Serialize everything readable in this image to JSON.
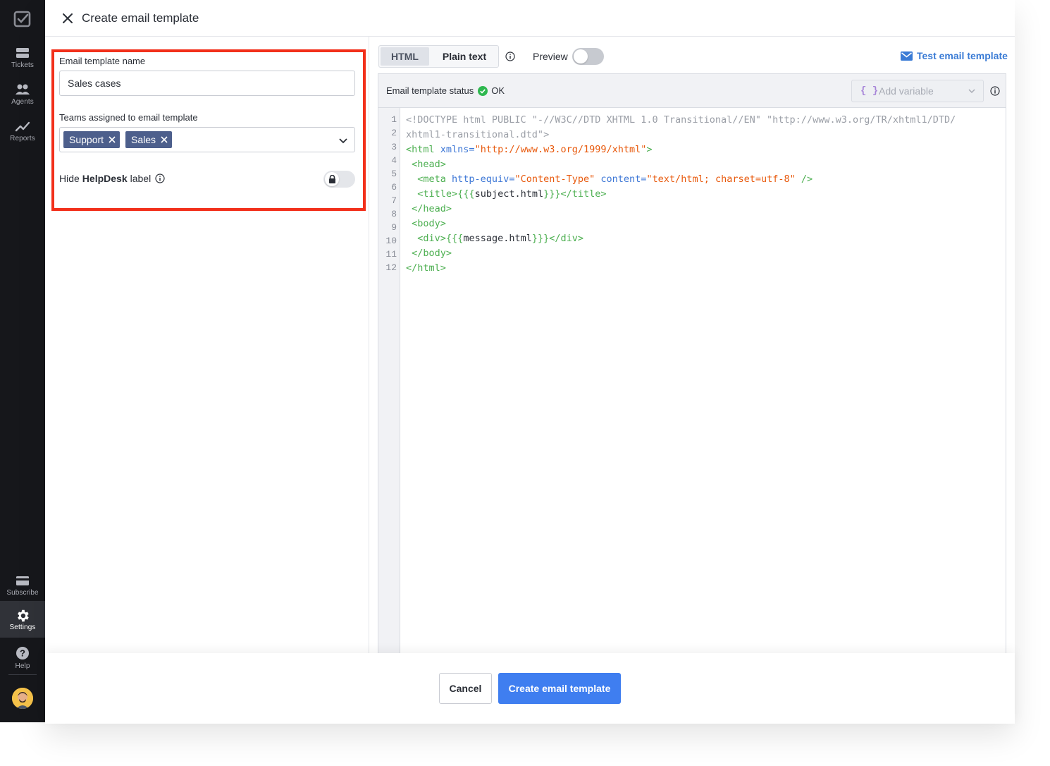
{
  "sidebar": {
    "items": [
      {
        "label": "Tickets",
        "icon": "tickets-icon"
      },
      {
        "label": "Agents",
        "icon": "agents-icon"
      },
      {
        "label": "Reports",
        "icon": "reports-icon"
      },
      {
        "label": "Subscribe",
        "icon": "subscribe-icon"
      },
      {
        "label": "Settings",
        "icon": "gear-icon",
        "active": true
      },
      {
        "label": "Help",
        "icon": "help-icon"
      }
    ]
  },
  "header": {
    "title": "Create email template"
  },
  "form": {
    "name_label": "Email template name",
    "name_value": "Sales cases",
    "teams_label": "Teams assigned to email template",
    "teams": [
      "Support",
      "Sales"
    ],
    "hide_prefix": "Hide",
    "hide_brand": "HelpDesk",
    "hide_suffix": "label",
    "hide_locked": true
  },
  "editor": {
    "tabs": [
      "HTML",
      "Plain text"
    ],
    "active_tab": "HTML",
    "preview_label": "Preview",
    "preview_on": false,
    "test_link": "Test email template",
    "status_label": "Email template status",
    "status_value": "OK",
    "add_variable": "Add variable",
    "line_numbers": [
      "1",
      "2",
      "3",
      "4",
      "5",
      "6",
      "7",
      "8",
      "9",
      "10",
      "11",
      "12"
    ],
    "code_lines": [
      "<!DOCTYPE html PUBLIC \"-//W3C//DTD XHTML 1.0 Transitional//EN\" \"http://www.w3.org/TR/xhtml1/DTD/",
      "xhtml1-transitional.dtd\">",
      "<html xmlns=\"http://www.w3.org/1999/xhtml\">",
      " <head>",
      "  <meta http-equiv=\"Content-Type\" content=\"text/html; charset=utf-8\" />",
      "  <title>{{{subject.html}}}</title>",
      " </head>",
      " <body>",
      "  <div>{{{message.html}}}</div>",
      " </body>",
      "</html>"
    ]
  },
  "footer": {
    "cancel": "Cancel",
    "create": "Create email template"
  },
  "colors": {
    "accent": "#3f7ef0",
    "highlight": "#f2301b",
    "chip": "#4d5f8c",
    "ok": "#2eb84f"
  }
}
